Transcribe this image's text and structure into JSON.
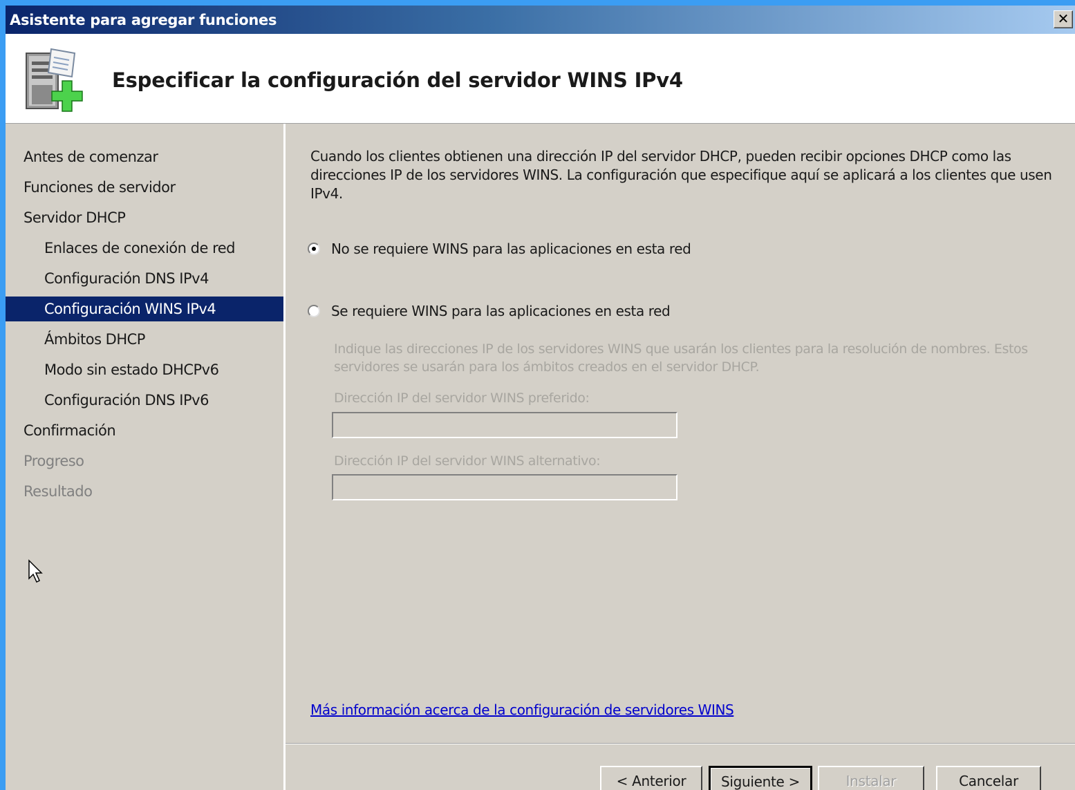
{
  "window": {
    "title": "Asistente para agregar funciones",
    "close_glyph": "✕"
  },
  "header": {
    "icon": "server-add-icon",
    "heading": "Especificar la configuración del servidor WINS IPv4"
  },
  "sidebar": {
    "items": [
      {
        "label": "Antes de comenzar",
        "level": 0,
        "state": "normal"
      },
      {
        "label": "Funciones de servidor",
        "level": 0,
        "state": "normal"
      },
      {
        "label": "Servidor DHCP",
        "level": 0,
        "state": "normal"
      },
      {
        "label": "Enlaces de conexión de red",
        "level": 1,
        "state": "normal"
      },
      {
        "label": "Configuración DNS IPv4",
        "level": 1,
        "state": "normal"
      },
      {
        "label": "Configuración WINS IPv4",
        "level": 1,
        "state": "selected"
      },
      {
        "label": "Ámbitos DHCP",
        "level": 1,
        "state": "normal"
      },
      {
        "label": "Modo sin estado DHCPv6",
        "level": 1,
        "state": "normal"
      },
      {
        "label": "Configuración DNS IPv6",
        "level": 1,
        "state": "normal"
      },
      {
        "label": "Confirmación",
        "level": 0,
        "state": "normal"
      },
      {
        "label": "Progreso",
        "level": 0,
        "state": "disabled"
      },
      {
        "label": "Resultado",
        "level": 0,
        "state": "disabled"
      }
    ]
  },
  "content": {
    "description": "Cuando los clientes obtienen una dirección IP del servidor DHCP, pueden recibir opciones DHCP como las direcciones IP de los servidores WINS. La configuración que especifique aquí se aplicará a los clientes que usen IPv4.",
    "option_no_wins": "No se requiere WINS para las aplicaciones en esta red",
    "option_wins": "Se requiere WINS para las aplicaciones en esta red",
    "selected_option": "no_wins",
    "wins_hint": "Indique las direcciones IP de los servidores WINS que usarán los clientes para la resolución de nombres. Estos servidores se usarán para los ámbitos creados en el servidor DHCP.",
    "preferred_label": "Dirección IP del servidor WINS preferido:",
    "preferred_value": "",
    "alternate_label": "Dirección IP del servidor WINS alternativo:",
    "alternate_value": "",
    "more_info_link": "Más información acerca de la configuración de servidores WINS"
  },
  "buttons": {
    "back": "< Anterior",
    "next": "Siguiente >",
    "install": "Instalar",
    "cancel": "Cancelar"
  },
  "colors": {
    "title_bar": "#0a246a",
    "selection": "#0a246a",
    "dialog_bg": "#d4d0c8",
    "link": "#0000cc",
    "disabled_text": "#a8a6a0"
  }
}
